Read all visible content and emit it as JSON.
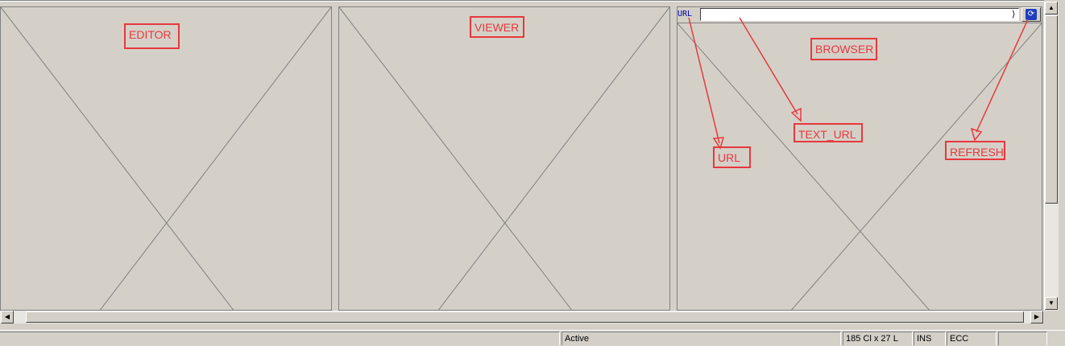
{
  "panels": {
    "editor": {
      "callout": "EDITOR"
    },
    "viewer": {
      "callout": "VIEWER"
    },
    "browser": {
      "callout": "BROWSER",
      "url_label": "URL",
      "url_value": "",
      "url_input_end_glyph": "⟩",
      "refresh_icon": "refresh-icon"
    }
  },
  "annotations": {
    "url": "URL",
    "text_url": "TEXT_URL",
    "refresh": "REFRESH",
    "color": "#e8383d"
  },
  "scrollbars": {
    "up_glyph": "▲",
    "down_glyph": "▼",
    "left_glyph": "◀",
    "right_glyph": "▶"
  },
  "statusbar": {
    "state": "Active",
    "position": "185 Cl x 27 L",
    "mode": "INS",
    "encoding": "ECC"
  }
}
